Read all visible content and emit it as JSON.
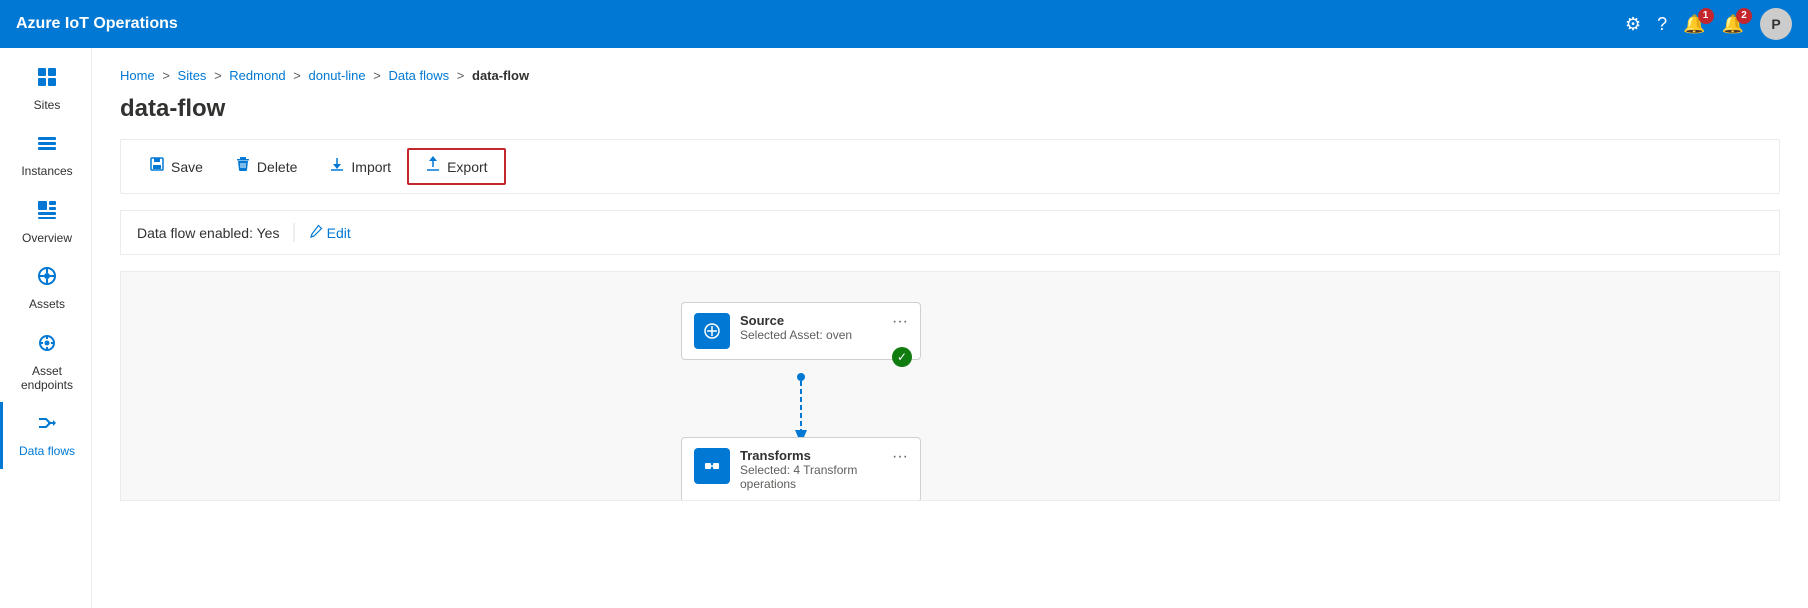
{
  "app": {
    "title": "Azure IoT Operations"
  },
  "topnav": {
    "title": "Azure IoT Operations",
    "icons": {
      "settings": "⚙",
      "help": "?",
      "bell1_count": "1",
      "bell2_count": "2",
      "avatar_label": "P"
    }
  },
  "sidebar": {
    "items": [
      {
        "id": "sites",
        "label": "Sites",
        "icon": "⊞",
        "active": false
      },
      {
        "id": "instances",
        "label": "Instances",
        "icon": "☰",
        "active": false
      },
      {
        "id": "overview",
        "label": "Overview",
        "icon": "▦",
        "active": false
      },
      {
        "id": "assets",
        "label": "Assets",
        "icon": "◈",
        "active": false
      },
      {
        "id": "asset-endpoints",
        "label": "Asset endpoints",
        "icon": "✳",
        "active": false
      },
      {
        "id": "data-flows",
        "label": "Data flows",
        "icon": "⇄",
        "active": true
      }
    ]
  },
  "breadcrumb": {
    "items": [
      "Home",
      "Sites",
      "Redmond",
      "donut-line",
      "Data flows"
    ],
    "current": "data-flow"
  },
  "page": {
    "title": "data-flow"
  },
  "toolbar": {
    "save_label": "Save",
    "delete_label": "Delete",
    "import_label": "Import",
    "export_label": "Export"
  },
  "infobar": {
    "enabled_label": "Data flow enabled: Yes",
    "edit_label": "Edit"
  },
  "flow": {
    "source_node": {
      "title": "Source",
      "subtitle": "Selected Asset: oven",
      "status": "✓"
    },
    "transforms_node": {
      "title": "Transforms",
      "subtitle": "Selected: 4 Transform operations"
    }
  }
}
